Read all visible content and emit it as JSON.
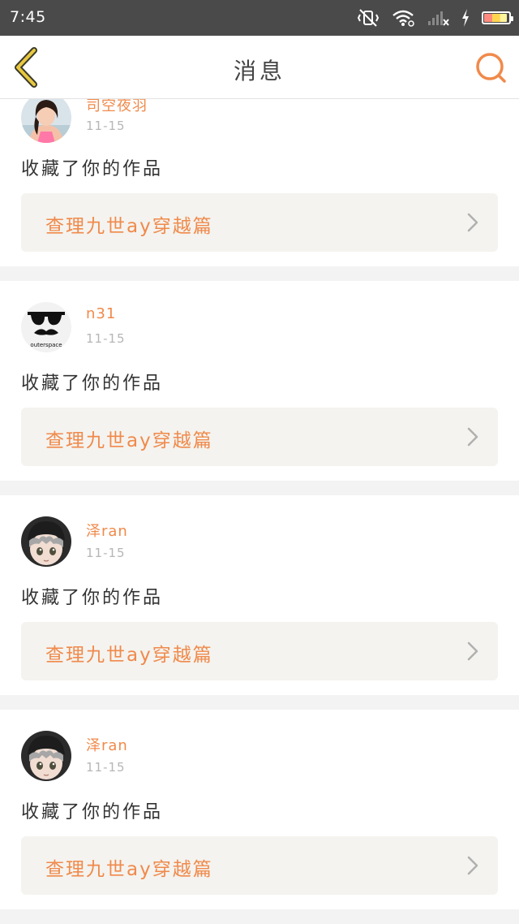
{
  "status_bar": {
    "time": "7:45",
    "icons": [
      "vibrate-off-icon",
      "wifi-icon",
      "signal-icon",
      "charging-icon",
      "battery-icon"
    ]
  },
  "header": {
    "title": "消息",
    "back_icon": "chevron-left-icon",
    "search_icon": "search-icon"
  },
  "accent_color": "#f08a4b",
  "messages": [
    {
      "username": "司空夜羽",
      "date": "11-15",
      "action": "收藏了你的作品",
      "work_title": "查理九世ay穿越篇",
      "avatar": "girl-photo-avatar"
    },
    {
      "username": "n31",
      "date": "11-15",
      "action": "收藏了你的作品",
      "work_title": "查理九世ay穿越篇",
      "avatar": "sunglasses-mustache-avatar",
      "avatar_text": "outerspace"
    },
    {
      "username": "泽ran",
      "date": "11-15",
      "action": "收藏了你的作品",
      "work_title": "查理九世ay穿越篇",
      "avatar": "anime-boy-hat-avatar"
    },
    {
      "username": "泽ran",
      "date": "11-15",
      "action": "收藏了你的作品",
      "work_title": "查理九世ay穿越篇",
      "avatar": "anime-boy-hat-avatar"
    }
  ]
}
